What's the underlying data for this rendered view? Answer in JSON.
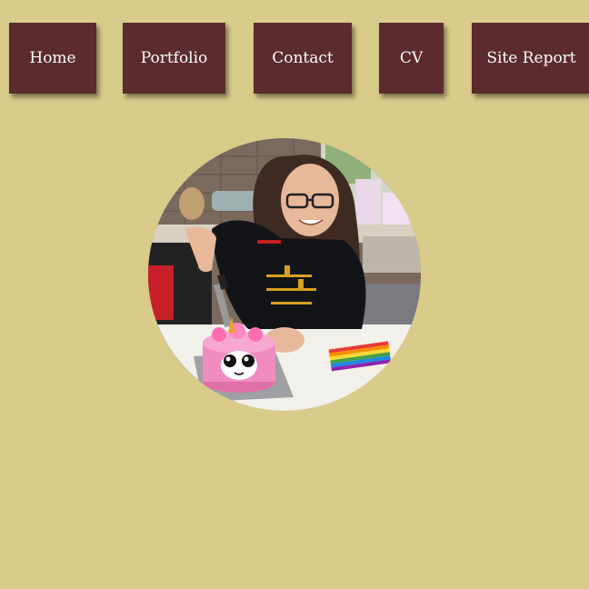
{
  "nav": {
    "items": [
      {
        "label": "Home"
      },
      {
        "label": "Portfolio"
      },
      {
        "label": "Contact"
      },
      {
        "label": "CV"
      },
      {
        "label": "Site Report"
      }
    ]
  },
  "profile_photo": {
    "icon": "profile-photo"
  },
  "colors": {
    "background": "#d9cb8a",
    "nav_button": "#5c2b2d",
    "nav_text": "#ffffff"
  }
}
